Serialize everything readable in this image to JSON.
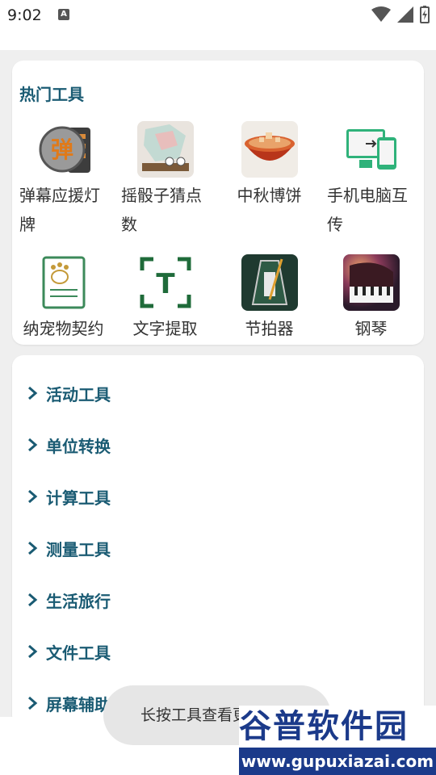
{
  "status_bar": {
    "time": "9:02",
    "notification_icon_letter": "A",
    "icons": [
      "wifi-icon",
      "signal-icon",
      "battery-charging-icon"
    ]
  },
  "hot_tools": {
    "title": "热门工具",
    "items": [
      {
        "label": "弹幕应援灯牌",
        "icon": "danmu-icon"
      },
      {
        "label": "摇骰子猜点数",
        "icon": "dice-icon"
      },
      {
        "label": "中秋博饼",
        "icon": "mooncake-icon"
      },
      {
        "label": "手机电脑互传",
        "icon": "phone-pc-transfer-icon"
      },
      {
        "label": "纳宠物契约",
        "icon": "pet-contract-icon"
      },
      {
        "label": "文字提取",
        "icon": "text-extract-icon"
      },
      {
        "label": "节拍器",
        "icon": "metronome-icon"
      },
      {
        "label": "钢琴",
        "icon": "piano-icon"
      }
    ]
  },
  "categories": [
    "活动工具",
    "单位转换",
    "计算工具",
    "测量工具",
    "生活旅行",
    "文件工具",
    "屏幕辅助"
  ],
  "toast": {
    "text": "长按工具查看更多选项"
  },
  "watermark": {
    "main": "谷普软件园",
    "url": "www.gupuxiazai.com"
  },
  "colors": {
    "accent": "#1a5b73",
    "background": "#efefef",
    "card": "#ffffff"
  }
}
